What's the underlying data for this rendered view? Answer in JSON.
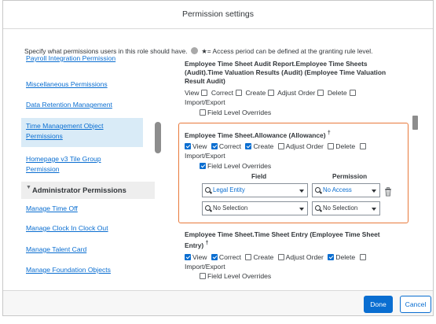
{
  "dialog": {
    "title": "Permission settings",
    "instructions_before": "Specify what permissions users in this role should have.",
    "instructions_after": "★= Access period can be defined at the granting rule level."
  },
  "left_nav": {
    "items": [
      "Payroll Integration Permission",
      "Miscellaneous Permissions",
      "Data Retention Management",
      "Time Management Object Permissions",
      "Homepage v3 Tile Group Permission"
    ],
    "group_label": "Administrator Permissions",
    "group_items": [
      "Manage Time Off",
      "Manage Clock In Clock Out",
      "Manage Talent Card",
      "Manage Foundation Objects"
    ]
  },
  "sections": [
    {
      "title": "Employee Time Sheet Audit Report.Employee Time Sheets (Audit).Time Valuation Results (Audit) (Employee Time Valuation Result Audit)",
      "checks": [
        {
          "label": "View",
          "checked": false
        },
        {
          "label": "Correct",
          "checked": false
        },
        {
          "label": "Create",
          "checked": false
        },
        {
          "label": "Adjust Order",
          "checked": false
        },
        {
          "label": "Delete",
          "checked": false
        }
      ],
      "extra_label": "Import/Export",
      "field_override": {
        "label": "Field Level Overrides",
        "checked": false
      }
    },
    {
      "title": "Employee Time Sheet.Allowance (Allowance)",
      "title_mark": "†",
      "checks": [
        {
          "label": "View",
          "checked": true
        },
        {
          "label": "Correct",
          "checked": true
        },
        {
          "label": "Create",
          "checked": false
        },
        {
          "label": "Adjust Order",
          "checked": false
        },
        {
          "label": "Delete",
          "checked": false
        }
      ],
      "extra_label": "Import/Export",
      "field_override": {
        "label": "Field Level Overrides",
        "checked": true
      },
      "table": {
        "col_field": "Field",
        "col_permission": "Permission",
        "rows": [
          {
            "field": "Legal Entity",
            "permission": "No Access"
          },
          {
            "field": "No Selection",
            "permission": "No Selection"
          }
        ]
      }
    },
    {
      "title": "Employee Time Sheet.Time Sheet Entry (Employee Time Sheet Entry)",
      "title_mark": "†",
      "checks": [
        {
          "label": "View",
          "checked": true
        },
        {
          "label": "Correct",
          "checked": true
        },
        {
          "label": "Create",
          "checked": false
        },
        {
          "label": "Adjust Order",
          "checked": false
        },
        {
          "label": "Delete",
          "checked": true
        }
      ],
      "extra_label": "Import/Export",
      "field_override": {
        "label": "Field Level Overrides",
        "checked": false
      }
    }
  ],
  "footer": {
    "done": "Done",
    "cancel": "Cancel"
  },
  "colors": {
    "accent": "#0a6ed1",
    "highlight_border": "#e8793b"
  }
}
